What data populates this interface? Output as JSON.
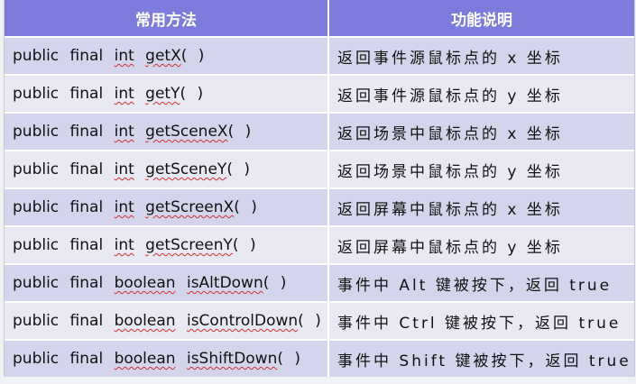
{
  "table": {
    "headers": [
      "常用方法",
      "功能说明"
    ],
    "rows": [
      {
        "prefix": "public final",
        "type": "int",
        "method": "getX",
        "parens": "( )",
        "desc": "返回事件源鼠标点的 x 坐标"
      },
      {
        "prefix": "public final",
        "type": "int",
        "method": "getY",
        "parens": "( )",
        "desc": "返回事件源鼠标点的 y 坐标"
      },
      {
        "prefix": "public final",
        "type": "int",
        "method": "getSceneX",
        "parens": "( )",
        "desc": "返回场景中鼠标点的 x 坐标"
      },
      {
        "prefix": "public final",
        "type": "int",
        "method": "getSceneY",
        "parens": "( )",
        "desc": "返回场景中鼠标点的 y 坐标"
      },
      {
        "prefix": "public final",
        "type": "int",
        "method": "getScreenX",
        "parens": "( )",
        "desc": "返回屏幕中鼠标点的 x 坐标"
      },
      {
        "prefix": "public final",
        "type": "int",
        "method": "getScreenY",
        "parens": "( )",
        "desc": "返回屏幕中鼠标点的 y 坐标"
      },
      {
        "prefix": "public final",
        "type": "boolean",
        "method": "isAltDown",
        "parens": "( )",
        "desc": "事件中 Alt 键被按下，返回 true"
      },
      {
        "prefix": "public final",
        "type": "boolean",
        "method": "isControlDown",
        "parens": "( )",
        "desc": "事件中 Ctrl 键被按下，返回 true"
      },
      {
        "prefix": "public final",
        "type": "boolean",
        "method": "isShiftDown",
        "parens": "( )",
        "desc": "事件中 Shift 键被按下，返回 true"
      }
    ]
  }
}
